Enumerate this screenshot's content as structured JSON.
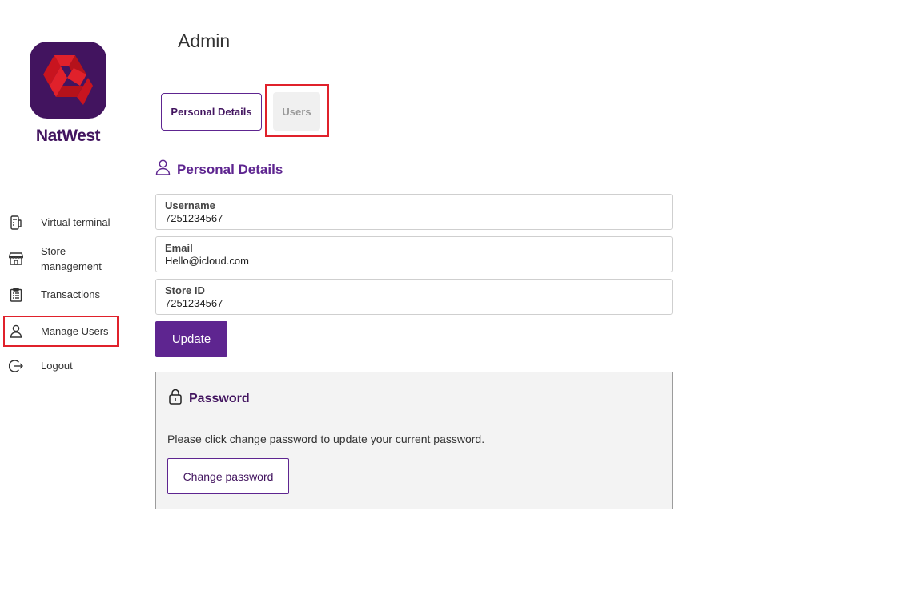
{
  "brand": {
    "name": "NatWest",
    "logo_icon": "natwest-chevrons-logo",
    "tile_color": "#42145f",
    "mark_color": "#e0212b"
  },
  "sidebar": {
    "items": [
      {
        "label": "Virtual terminal",
        "icon": "card-terminal-icon"
      },
      {
        "label": "Store management",
        "icon": "storefront-icon"
      },
      {
        "label": "Transactions",
        "icon": "clipboard-list-icon"
      },
      {
        "label": "Manage Users",
        "icon": "user-icon",
        "highlighted": true
      },
      {
        "label": "Logout",
        "icon": "logout-icon"
      }
    ]
  },
  "header": {
    "title": "Admin"
  },
  "tabs": [
    {
      "label": "Personal Details",
      "active": true
    },
    {
      "label": "Users",
      "active": false,
      "highlighted": true
    }
  ],
  "personal_details": {
    "heading": "Personal Details",
    "fields": [
      {
        "label": "Username",
        "value": "7251234567"
      },
      {
        "label": "Email",
        "value": "Hello@icloud.com"
      },
      {
        "label": "Store ID",
        "value": "7251234567"
      }
    ],
    "update_label": "Update"
  },
  "password": {
    "heading": "Password",
    "description": "Please click change password to update your current password.",
    "button_label": "Change password"
  },
  "colors": {
    "accent": "#5e2590",
    "brand": "#42145f",
    "highlight": "#e0212b",
    "panel_bg": "#f3f3f3"
  }
}
